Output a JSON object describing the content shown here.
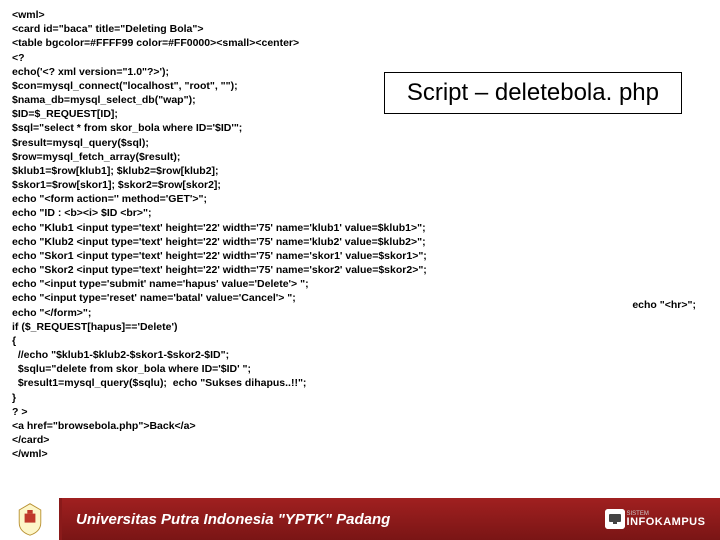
{
  "title": "Script – deletebola. php",
  "side_note": "echo \"<hr>\";",
  "code_lines": [
    "<wml>",
    "<card id=\"baca\" title=\"Deleting Bola\">",
    "<table bgcolor=#FFFF99 color=#FF0000><small><center>",
    "<?",
    "echo('<? xml version=\"1.0\"?>');",
    "$con=mysql_connect(\"localhost\", \"root\", \"\");",
    "$nama_db=mysql_select_db(\"wap\");",
    "$ID=$_REQUEST[ID];",
    "$sql=\"select * from skor_bola where ID='$ID'\";",
    "$result=mysql_query($sql);",
    "$row=mysql_fetch_array($result);",
    "$klub1=$row[klub1]; $klub2=$row[klub2];",
    "$skor1=$row[skor1]; $skor2=$row[skor2];",
    "echo \"<form action='' method='GET'>\";",
    "echo \"ID : <b><i> $ID <br>\";",
    "echo \"Klub1 <input type='text' height='22' width='75' name='klub1' value=$klub1>\";",
    "echo \"Klub2 <input type='text' height='22' width='75' name='klub2' value=$klub2>\";",
    "echo \"Skor1 <input type='text' height='22' width='75' name='skor1' value=$skor1>\";",
    "echo \"Skor2 <input type='text' height='22' width='75' name='skor2' value=$skor2>\";",
    "echo \"<input type='submit' name='hapus' value='Delete'> \";",
    "echo \"<input type='reset' name='batal' value='Cancel'> \";",
    "echo \"</form>\";",
    "if ($_REQUEST[hapus]=='Delete')",
    "{",
    "  //echo \"$klub1-$klub2-$skor1-$skor2-$ID\";",
    "  $sqlu=\"delete from skor_bola where ID='$ID' \";",
    "  $result1=mysql_query($sqlu);  echo \"Sukses dihapus..!!\";",
    "}",
    "? >",
    "<a href=\"browsebola.php\">Back</a>",
    "</card>",
    "</wml>"
  ],
  "footer": {
    "university": "Universitas Putra Indonesia \"YPTK\" Padang",
    "brand_small": "SISTEM",
    "brand_main": "INFOKAMPUS"
  }
}
